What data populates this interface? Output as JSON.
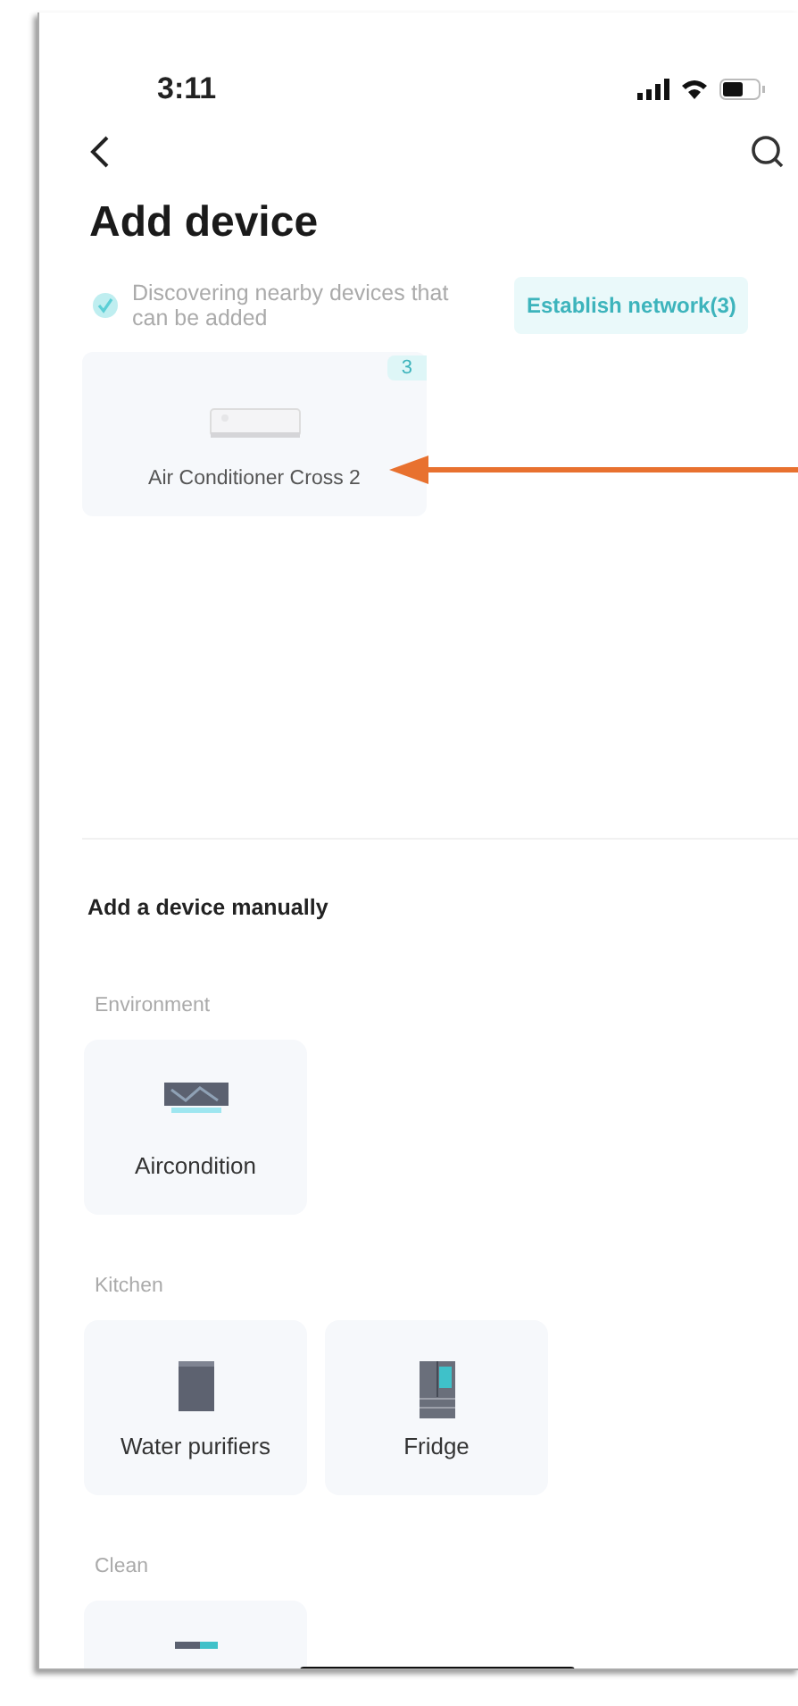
{
  "status_bar": {
    "time": "3:11"
  },
  "header": {
    "title": "Add device"
  },
  "discovery": {
    "text": "Discovering nearby devices that can be added",
    "button": "Establish network(3)"
  },
  "discovered_devices": [
    {
      "name": "Air Conditioner Cross 2",
      "badge": "3",
      "kind": "ac"
    }
  ],
  "manual": {
    "title": "Add a device manually",
    "categories": [
      {
        "name": "Environment",
        "devices": [
          {
            "name": "Aircondition",
            "kind": "aircon"
          }
        ]
      },
      {
        "name": "Kitchen",
        "devices": [
          {
            "name": "Water purifiers",
            "kind": "purifier"
          },
          {
            "name": "Fridge",
            "kind": "fridge"
          }
        ]
      },
      {
        "name": "Clean",
        "devices": [
          {
            "kind": "robot"
          }
        ]
      }
    ]
  }
}
